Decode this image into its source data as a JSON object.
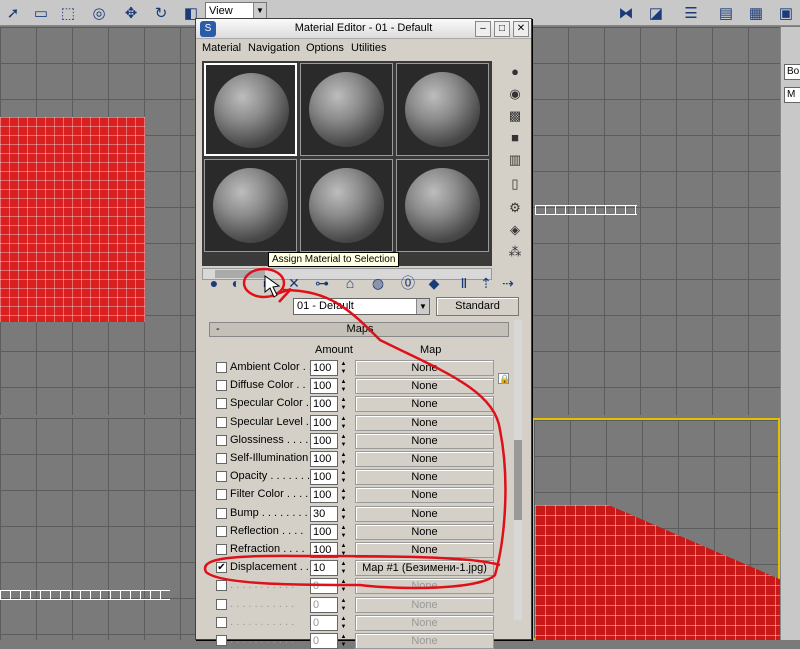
{
  "toolbar": {
    "view_select": "View",
    "icons": [
      "select-arrow-icon",
      "select-region-icon",
      "select-region-circle-icon",
      "select-name-icon",
      "move-icon",
      "rotate-icon",
      "scale-icon",
      "snap-icon",
      "angle-snap-icon",
      "percent-snap-icon",
      "mirror-icon",
      "align-icon",
      "layers-icon",
      "curve-editor-icon",
      "render-icon"
    ]
  },
  "window": {
    "title": "Material Editor - 01 - Default",
    "app_icon": "S",
    "menu": [
      "Material",
      "Navigation",
      "Options",
      "Utilities"
    ]
  },
  "side_tools": [
    "sample-type-icon",
    "backlight-icon",
    "background-icon",
    "tiling-icon",
    "video-color-check-icon",
    "make-preview-icon",
    "options-icon",
    "select-by-material-icon",
    "material-map-navigator-icon"
  ],
  "bottom_tools": [
    "get-material-icon",
    "put-to-scene-icon",
    "assign-material-icon",
    "reset-map-icon",
    "make-unique-icon",
    "put-to-library-icon",
    "material-id-icon",
    "show-map-icon",
    "show-end-result-icon",
    "go-to-parent-icon",
    "go-to-sibling-icon"
  ],
  "tooltip": "Assign Material to Selection",
  "material": {
    "name": "01 - Default",
    "type": "Standard"
  },
  "maps": {
    "section_label": "Maps",
    "minus": "-",
    "amount_header": "Amount",
    "map_header": "Map",
    "rows": [
      {
        "label": "Ambient Color . . .",
        "checked": false,
        "amount": "100",
        "map": "None"
      },
      {
        "label": "Diffuse Color . .",
        "checked": false,
        "amount": "100",
        "map": "None"
      },
      {
        "label": "Specular Color . .",
        "checked": false,
        "amount": "100",
        "map": "None"
      },
      {
        "label": "Specular Level . .",
        "checked": false,
        "amount": "100",
        "map": "None"
      },
      {
        "label": "Glossiness . . . . .",
        "checked": false,
        "amount": "100",
        "map": "None"
      },
      {
        "label": "Self-Illumination .",
        "checked": false,
        "amount": "100",
        "map": "None"
      },
      {
        "label": "Opacity . . . . . . .",
        "checked": false,
        "amount": "100",
        "map": "None"
      },
      {
        "label": "Filter Color . . . .",
        "checked": false,
        "amount": "100",
        "map": "None"
      },
      {
        "label": "Bump . . . . . . . .",
        "checked": false,
        "amount": "30",
        "map": "None"
      },
      {
        "label": "Reflection . . . .",
        "checked": false,
        "amount": "100",
        "map": "None"
      },
      {
        "label": "Refraction . . . .",
        "checked": false,
        "amount": "100",
        "map": "None"
      },
      {
        "label": "Displacement . .",
        "checked": true,
        "amount": "10",
        "map": "Map #1 (Безимени-1.jpg)"
      },
      {
        "label": ". . . . . . . . . . .",
        "checked": false,
        "amount": "0",
        "map": "None",
        "dim": true
      },
      {
        "label": ". . . . . . . . . . .",
        "checked": false,
        "amount": "0",
        "map": "None",
        "dim": true
      },
      {
        "label": ". . . . . . . . . . .",
        "checked": false,
        "amount": "0",
        "map": "None",
        "dim": true
      },
      {
        "label": ". . . . . . . . . . .",
        "checked": false,
        "amount": "0",
        "map": "None",
        "dim": true
      }
    ]
  },
  "right_panel": {
    "fields": [
      "Bo",
      "M"
    ]
  },
  "colors": {
    "annotation": "#e0101a",
    "red_mesh": "#d82020",
    "active_viewport_border": "#e0c000"
  }
}
